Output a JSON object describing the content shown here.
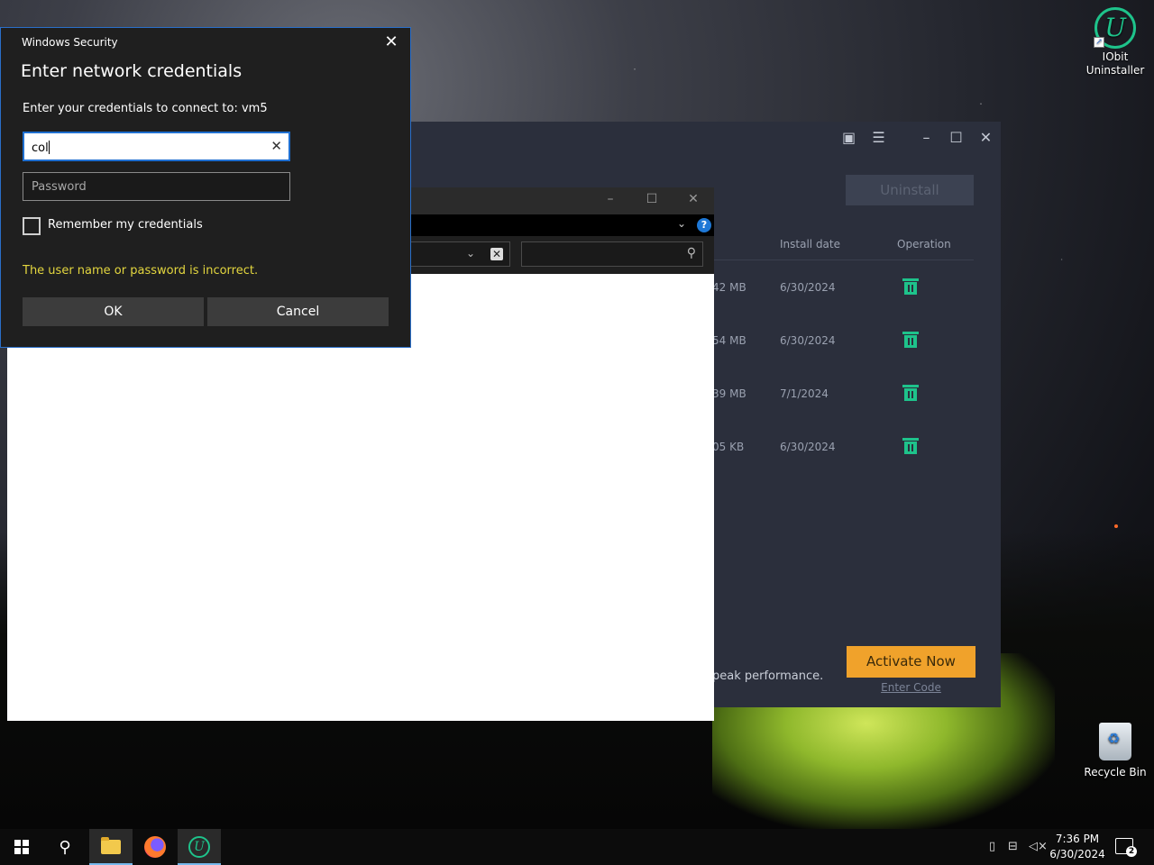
{
  "desktop": {
    "icons": [
      {
        "label_line1": "IObit",
        "label_line2": "Uninstaller",
        "glyph": "U"
      },
      {
        "label_line1": "Recycle Bin",
        "label_line2": ""
      }
    ]
  },
  "iobit": {
    "window_controls": {
      "toolbox_icon": "briefcase-icon",
      "menu_icon": "hamburger-icon",
      "minimize": "–",
      "maximize": "☐",
      "close": "✕"
    },
    "uninstall_label": "Uninstall",
    "columns": {
      "install_date": "Install date",
      "operation": "Operation"
    },
    "rows": [
      {
        "size": "42 MB",
        "date": "6/30/2024"
      },
      {
        "size": "54 MB",
        "date": "6/30/2024"
      },
      {
        "size": "39 MB",
        "date": "7/1/2024"
      },
      {
        "size": "05 KB",
        "date": "6/30/2024"
      }
    ],
    "promo_text": "peak performance.",
    "activate_label": "Activate Now",
    "enter_code_label": "Enter Code",
    "accent_color": "#1ec38b",
    "activate_color": "#f0a22b"
  },
  "explorer": {
    "controls": {
      "minimize": "–",
      "maximize": "☐",
      "close": "✕"
    },
    "help": "?"
  },
  "dialog": {
    "app_title": "Windows Security",
    "heading": "Enter network credentials",
    "prompt": "Enter your credentials to connect to: vm5",
    "username_value": "col",
    "password_placeholder": "Password",
    "remember_label": "Remember my credentials",
    "error_text": "The user name or password is incorrect.",
    "ok_label": "OK",
    "cancel_label": "Cancel",
    "error_color": "#e3d63f"
  },
  "taskbar": {
    "time": "7:36 PM",
    "date": "6/30/2024",
    "notification_count": "2",
    "iobit_glyph": "U"
  }
}
